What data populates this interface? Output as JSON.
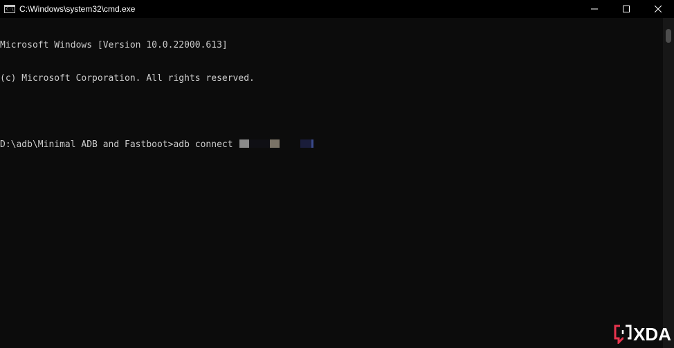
{
  "window": {
    "title": "C:\\Windows\\system32\\cmd.exe",
    "icon": "cmd-app-icon",
    "icon_text": "C:\\"
  },
  "controls": {
    "minimize_icon": "minimize-icon",
    "maximize_icon": "maximize-icon",
    "close_icon": "close-icon"
  },
  "console": {
    "line1": "Microsoft Windows [Version 10.0.22000.613]",
    "line2": "(c) Microsoft Corporation. All rights reserved.",
    "prompt": "D:\\adb\\Minimal ADB and Fastboot>",
    "command": "adb connect "
  },
  "watermark": {
    "text": "XDA",
    "accent_color": "#e8344e"
  },
  "colors": {
    "background": "#0c0c0c",
    "text": "#cccccc",
    "titlebar": "#000000"
  }
}
